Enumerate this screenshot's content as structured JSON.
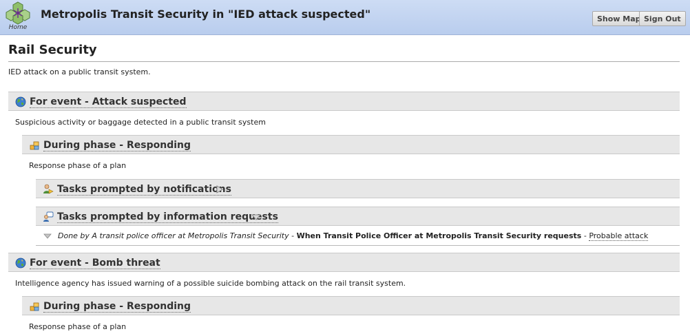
{
  "header": {
    "home_label": "Home",
    "title": "Metropolis Transit Security in \"IED attack suspected\"",
    "show_map_label": "Show Map",
    "sign_out_label": "Sign Out"
  },
  "page": {
    "title": "Rail Security",
    "description": "IED attack on a public transit system."
  },
  "events": [
    {
      "label": "For event - Attack suspected",
      "description": "Suspicious activity or baggage detected in a public transit system",
      "phase": {
        "label": "During phase - Responding",
        "description": "Response phase of a plan",
        "tasks": [
          {
            "label": "Tasks prompted by notifications",
            "expanded": false
          },
          {
            "label": "Tasks prompted by information requests",
            "expanded": true,
            "item": {
              "done_by": "Done by A transit police officer at Metropolis Transit Security",
              "sep1": " - ",
              "when": "When Transit Police Officer at Metropolis Transit Security requests",
              "sep2": " - ",
              "link": "Probable attack"
            }
          }
        ]
      }
    },
    {
      "label": "For event - Bomb threat",
      "description": "Intelligence agency has issued warning of a possible suicide bombing attack on the rail transit system.",
      "phase": {
        "label": "During phase - Responding",
        "description": "Response phase of a plan"
      }
    }
  ],
  "icons": {
    "home": "home-logo-icon",
    "event": "globe-icon",
    "phase": "phase-boxes-icon",
    "notifications": "person-notification-icon",
    "info_requests": "info-request-icon"
  }
}
